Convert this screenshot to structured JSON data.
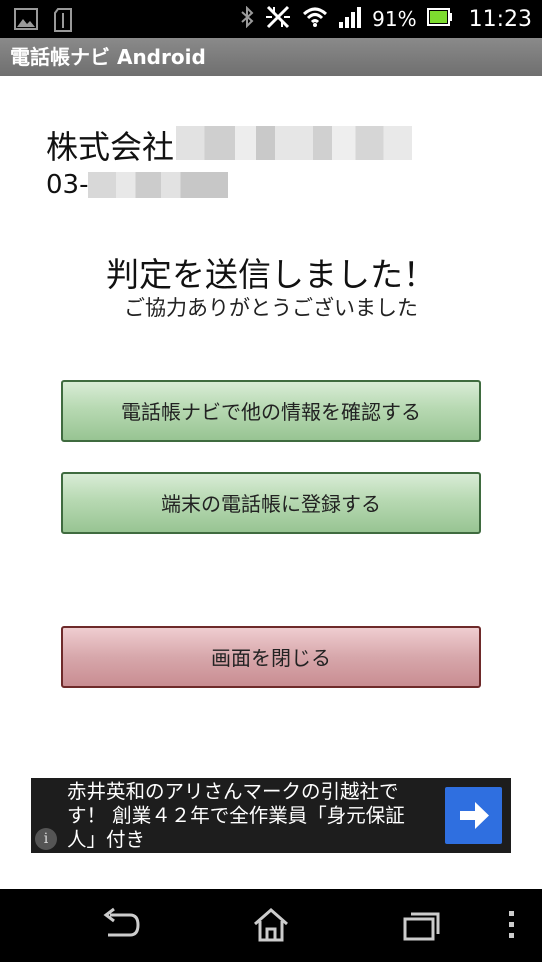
{
  "status_bar": {
    "battery_percent": "91%",
    "time": "11:23",
    "icons": [
      "picture-icon",
      "sim-icon",
      "bluetooth-icon",
      "nfc-icon",
      "wifi-icon",
      "signal-icon",
      "battery-icon"
    ]
  },
  "app": {
    "title": "電話帳ナビ Android"
  },
  "company": {
    "name_prefix": "株式会社",
    "phone_prefix": "03-"
  },
  "message": {
    "title": "判定を送信しました！",
    "subtitle": "ご協力ありがとうございました"
  },
  "buttons": {
    "check_info": "電話帳ナビで他の情報を確認する",
    "register": "端末の電話帳に登録する",
    "close": "画面を閉じる"
  },
  "ad": {
    "text": "赤井英和のアリさんマークの引越社です！ 創業４２年で全作業員「身元保証人」付き",
    "info_glyph": "i"
  },
  "navigation": {
    "icons": [
      "back-icon",
      "home-icon",
      "recent-apps-icon",
      "menu-icon"
    ]
  },
  "colors": {
    "green_button": "#b7d9b2",
    "red_button": "#d7a7ab",
    "ad_arrow": "#2f6fe0",
    "battery": "#7ddc2f"
  }
}
